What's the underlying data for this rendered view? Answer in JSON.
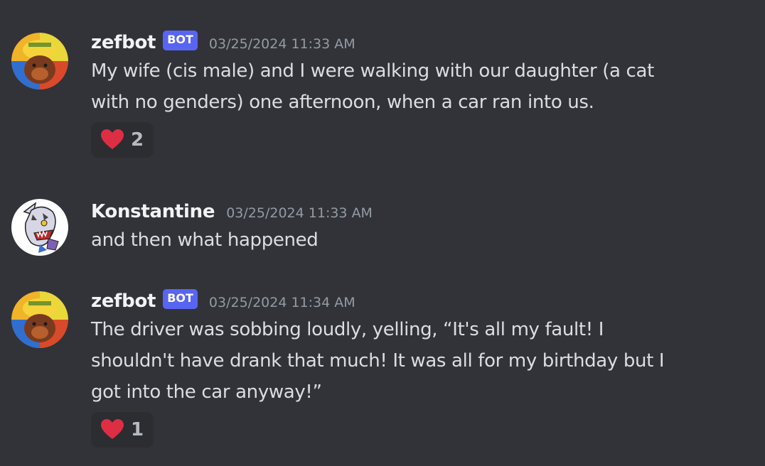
{
  "messages": [
    {
      "username": "zefbot",
      "tag": "BOT",
      "timestamp": "03/25/2024 11:33 AM",
      "text": "My wife (cis male) and I were walking with our daughter (a cat\nwith no genders) one afternoon, when a car ran into us.",
      "reaction": {
        "icon": "heart-icon",
        "count": "2"
      }
    },
    {
      "username": "Konstantine",
      "timestamp": "03/25/2024 11:33 AM",
      "text": "and then what happened"
    },
    {
      "username": "zefbot",
      "tag": "BOT",
      "timestamp": "03/25/2024 11:34 AM",
      "text": "The driver was sobbing loudly, yelling, “It's all my fault! I\nshouldn't have drank that much! It was all for my birthday but I\ngot into the car anyway!”",
      "reaction": {
        "icon": "heart-icon",
        "count": "1"
      }
    }
  ],
  "colors": {
    "background": "#313338",
    "bot_tag": "#5865f2",
    "reaction_bg": "#2b2d31",
    "heart": "#dd2e44"
  }
}
